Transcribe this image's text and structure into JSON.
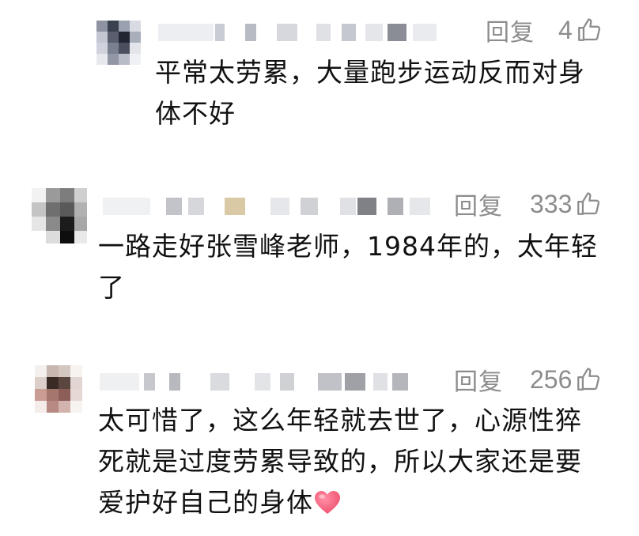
{
  "comments": [
    {
      "reply_label": "回复",
      "likes": "4",
      "lines": [
        "平常太劳累，大量跑步运动反而对身",
        "体不好"
      ]
    },
    {
      "reply_label": "回复",
      "likes": "333",
      "lines": [
        "一路走好张雪峰老师，1984年的，太年轻",
        "了"
      ]
    },
    {
      "reply_label": "回复",
      "likes": "256",
      "lines": [
        "太可惜了，这么年轻就去世了，心源性猝",
        "死就是过度劳累导致的，所以大家还是要",
        "爱护好自己的身体"
      ]
    }
  ],
  "icons": {
    "like": "thumbs-up-icon",
    "heart": "heart-emoji-icon"
  },
  "colors": {
    "meta_text": "#8c8c8c",
    "body_text": "#111111",
    "heart": "#f0506e"
  }
}
